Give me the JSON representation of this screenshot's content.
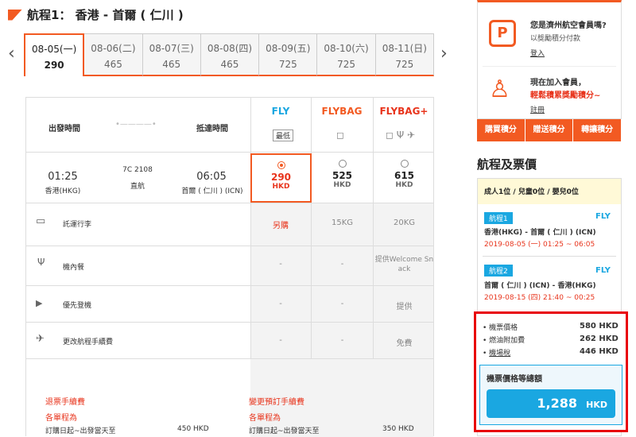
{
  "title": "航程1： 香港 - 首爾 ( 仁川 )",
  "dates": [
    {
      "d": "08-05(一)",
      "p": "290"
    },
    {
      "d": "08-06(二)",
      "p": "465"
    },
    {
      "d": "08-07(三)",
      "p": "465"
    },
    {
      "d": "08-08(四)",
      "p": "465"
    },
    {
      "d": "08-09(五)",
      "p": "725"
    },
    {
      "d": "08-10(六)",
      "p": "725"
    },
    {
      "d": "08-11(日)",
      "p": "725"
    }
  ],
  "hdr": {
    "dep": "出發時間",
    "arr": "抵達時間",
    "fly": "FLY",
    "flybag": "FLYBAG",
    "flybagplus": "FLYBAG+",
    "lowest": "最低"
  },
  "flight": {
    "dep_time": "01:25",
    "dep_place": "香港(HKG)",
    "no": "7C 2108",
    "type": "直航",
    "arr_time": "06:05",
    "arr_place": "首爾 ( 仁川 ) (ICN)"
  },
  "fares": [
    {
      "price": "290",
      "cur": "HKD"
    },
    {
      "price": "525",
      "cur": "HKD"
    },
    {
      "price": "615",
      "cur": "HKD"
    }
  ],
  "rows": [
    {
      "label": "託運行李",
      "v": [
        "另購",
        "15KG",
        "20KG"
      ]
    },
    {
      "label": "機內餐",
      "v": [
        "-",
        "-",
        "提供Welcome Snack"
      ]
    },
    {
      "label": "優先登機",
      "v": [
        "-",
        "-",
        "提供"
      ]
    },
    {
      "label": "更改航程手續費",
      "v": [
        "-",
        "-",
        "免費"
      ]
    }
  ],
  "rules": {
    "refund_title": "退票手續費",
    "change_title": "變更預訂手續費",
    "sub": "各單程為",
    "period": "訂購日起~出發當天至",
    "refund_amt": "450 HKD",
    "change_amt": "350 HKD"
  },
  "member": {
    "q": "您是濟州航空會員嗎?",
    "use": "以獎勵積分付款",
    "login": "登入",
    "join": "現在加入會員，",
    "bonus": "輕鬆積累獎勵積分~",
    "reg": "註冊",
    "btn1": "購買積分",
    "btn2": "贈送積分",
    "btn3": "轉讓積分"
  },
  "summary": {
    "title": "航程及票價",
    "pax": "成人1位 / 兒童0位 / 嬰兒0位",
    "legs": [
      {
        "badge": "航程1",
        "cls": "FLY",
        "route": "香港(HKG) - 首爾 ( 仁川 ) (ICN)",
        "time": "2019-08-05 (一) 01:25 ~ 06:05"
      },
      {
        "badge": "航程2",
        "cls": "FLY",
        "route": "首爾 ( 仁川 ) (ICN) - 香港(HKG)",
        "time": "2019-08-15 (四) 21:40 ~ 00:25"
      }
    ],
    "fare_l": "機票價格",
    "fare": "580 HKD",
    "fuel_l": "燃油附加費",
    "fuel": "262 HKD",
    "tax_l": "機場稅",
    "tax": "446 HKD",
    "total_l": "機票價格等總額",
    "total": "1,288",
    "total_cur": "HKD"
  },
  "colors": {
    "accent": "#f25a22",
    "blue": "#1aa7e1",
    "highlight": "#e8000b"
  }
}
